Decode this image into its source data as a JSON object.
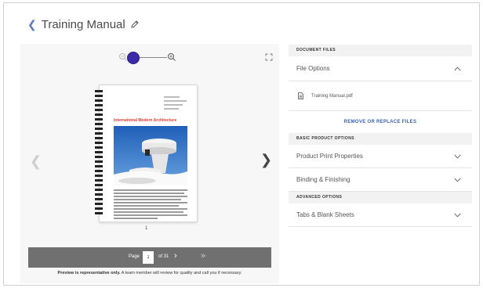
{
  "header": {
    "title": "Training Manual"
  },
  "preview": {
    "document": {
      "heading": "International Modern Architecture"
    },
    "page_indicator": "1",
    "pager": {
      "page_label": "Page",
      "current_page": "1",
      "total_label": "of 31",
      "next_glyph": "›",
      "last_glyph": "»"
    },
    "note_bold": "Preview is representative only.",
    "note_rest": " A team member will review for quality and call you if necessary."
  },
  "options": {
    "document_files": {
      "header": "DOCUMENT FILES",
      "file_options_label": "File Options",
      "file_name": "Training Manual.pdf",
      "remove_label": "REMOVE OR REPLACE FILES"
    },
    "basic": {
      "header": "BASIC PRODUCT OPTIONS",
      "items": [
        "Product Print Properties",
        "Binding & Finishing"
      ]
    },
    "advanced": {
      "header": "ADVANCED OPTIONS",
      "items": [
        "Tabs & Blank Sheets"
      ]
    }
  },
  "colors": {
    "accent": "#3a5fb0",
    "zoom_knob": "#3a2aa8",
    "doc_heading": "#e03a2f",
    "pager_bg": "#707070"
  },
  "icons": {
    "back": "chevron-left-icon",
    "edit": "pencil-icon",
    "zoom_out": "zoom-out-icon",
    "zoom_in": "zoom-in-icon",
    "fullscreen": "fullscreen-icon",
    "file": "file-icon"
  }
}
